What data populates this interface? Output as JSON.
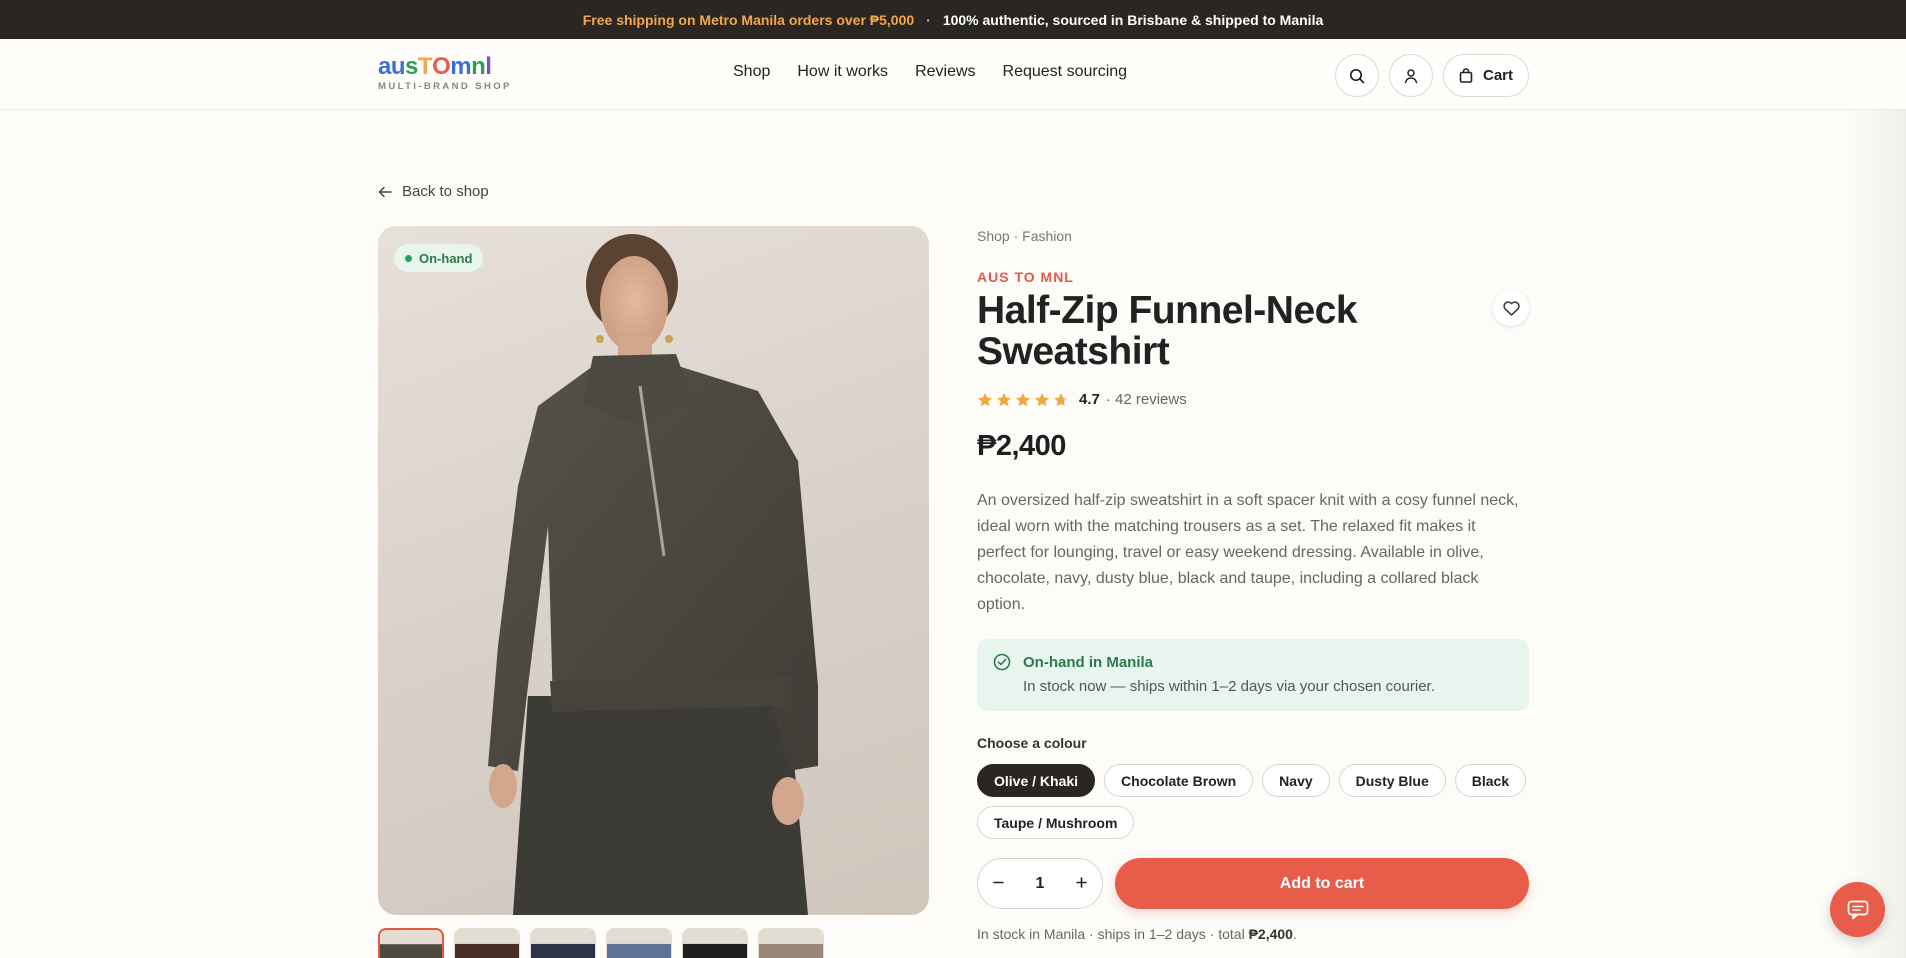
{
  "announcement": {
    "left": "Free shipping on Metro Manila orders over ₱5,000",
    "separator": "·",
    "right": "100% authentic, sourced in Brisbane & shipped to Manila"
  },
  "header": {
    "logo_letters": [
      {
        "ch": "a",
        "color": "#3b6fd8"
      },
      {
        "ch": "u",
        "color": "#3b6fd8"
      },
      {
        "ch": "s",
        "color": "#2c9d5d"
      },
      {
        "ch": "T",
        "color": "#f3a64a"
      },
      {
        "ch": "O",
        "color": "#e85c4a"
      },
      {
        "ch": "m",
        "color": "#3b6fd8"
      },
      {
        "ch": "n",
        "color": "#2c9d5d"
      },
      {
        "ch": "l",
        "color": "#7b4fc9"
      }
    ],
    "logo_sub": "MULTI-BRAND SHOP",
    "nav": [
      "Shop",
      "How it works",
      "Reviews",
      "Request sourcing"
    ],
    "cart_label": "Cart",
    "icons": [
      "search-icon",
      "user-icon",
      "bag-icon"
    ]
  },
  "back_link": "Back to shop",
  "product": {
    "badge": "On-hand",
    "breadcrumb": "Shop · Fashion",
    "brand": "AUS TO MNL",
    "title": "Half-Zip Funnel-Neck Sweatshirt",
    "rating_value": "4.7",
    "rating_stars": 4.7,
    "reviews": "· 42 reviews",
    "price": "₱2,400",
    "description": "An oversized half-zip sweatshirt in a soft spacer knit with a cosy funnel neck, ideal worn with the matching trousers as a set. The relaxed fit makes it perfect for lounging, travel or easy weekend dressing. Available in olive, chocolate, navy, dusty blue, black and taupe, including a collared black option.",
    "stock_title": "On-hand in Manila",
    "stock_text": "In stock now — ships within 1–2 days via your chosen courier.",
    "colour_label": "Choose a colour",
    "colours": [
      "Olive / Khaki",
      "Chocolate Brown",
      "Navy",
      "Dusty Blue",
      "Black",
      "Taupe / Mushroom"
    ],
    "selected_colour": "Olive / Khaki",
    "quantity": "1",
    "add_to_cart": "Add to cart",
    "footnote_prefix": "In stock in Manila · ships in 1–2 days · total ",
    "footnote_total": "₱2,400",
    "footnote_suffix": ".",
    "thumb_colors": [
      "#4d4a40",
      "#4a2f28",
      "#2c3445",
      "#5d7394",
      "#1e1e1e",
      "#9a8777"
    ]
  },
  "colors": {
    "accent": "#e85c4a",
    "dark": "#2a2723",
    "success": "#2c7a4b",
    "success_bg": "#e7f5ee",
    "star": "#f0a93a"
  }
}
